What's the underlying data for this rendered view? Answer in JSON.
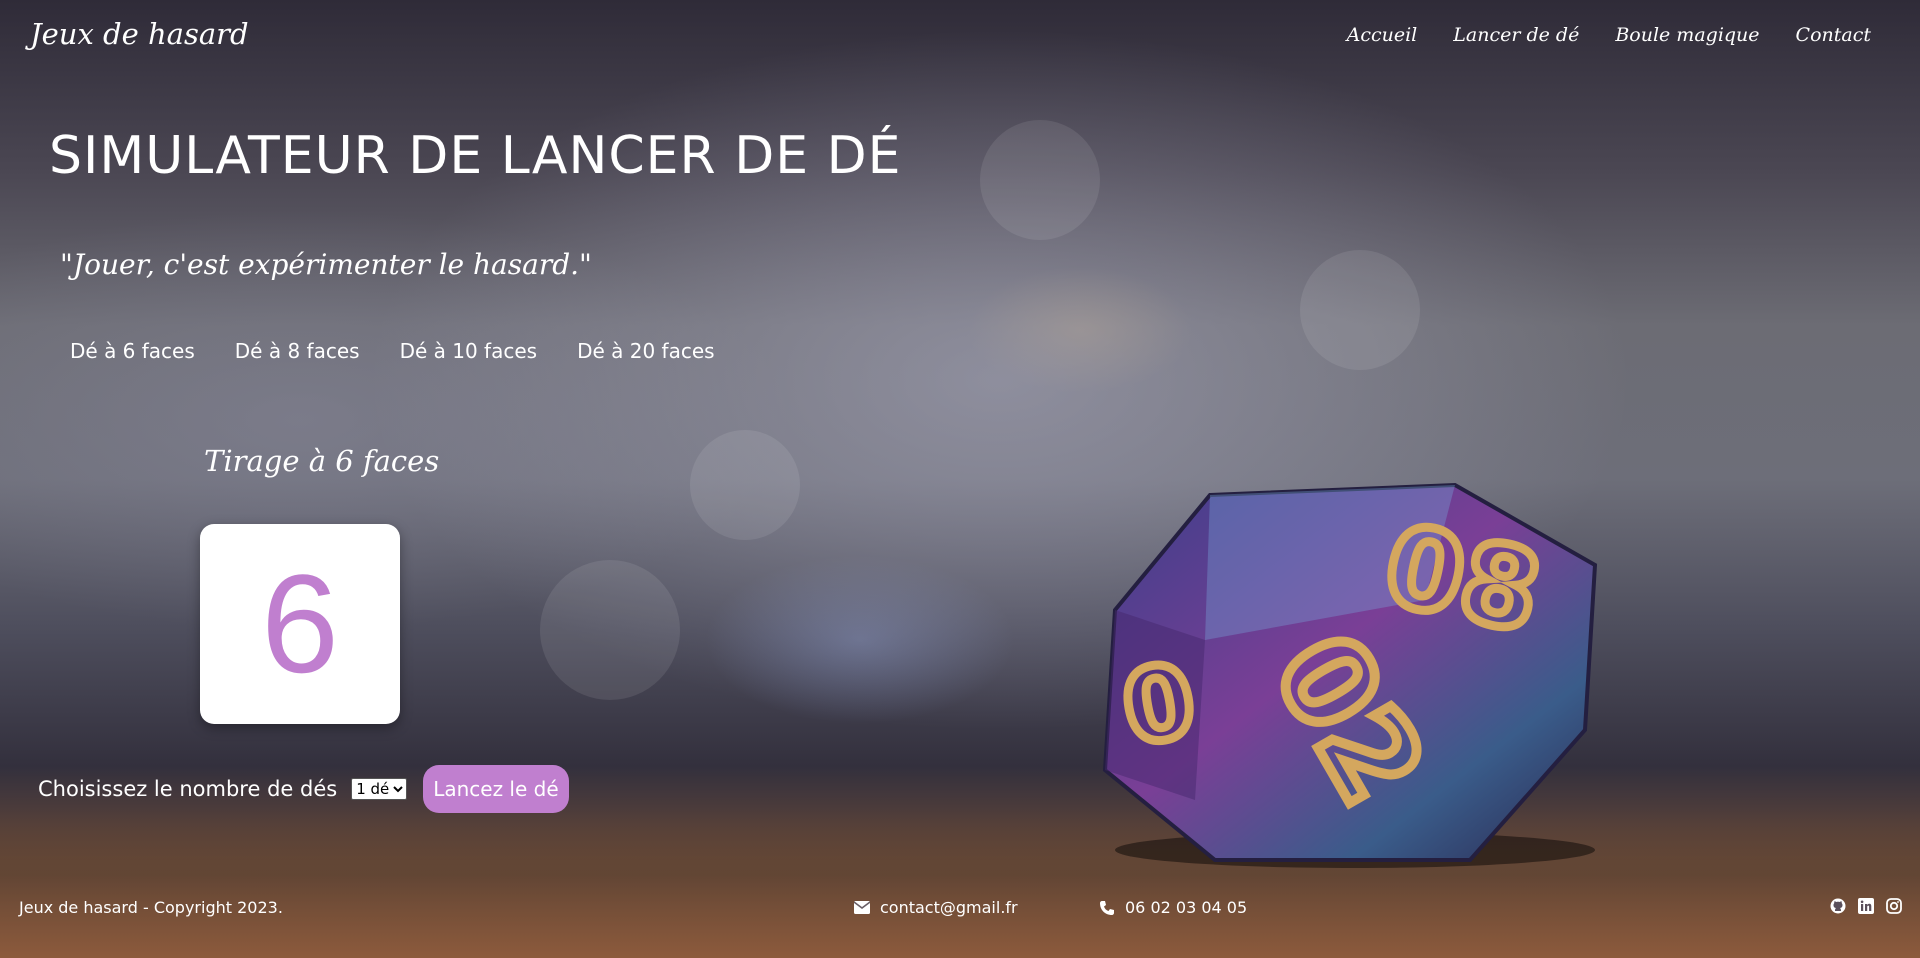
{
  "header": {
    "brand": "Jeux de hasard",
    "nav": [
      "Accueil",
      "Lancer de dé",
      "Boule magique",
      "Contact"
    ]
  },
  "main": {
    "title": "SIMULATEUR DE LANCER DE DÉ",
    "quote": "\"Jouer, c'est expérimenter le hasard.\"",
    "die_tabs": [
      "Dé à 6 faces",
      "Dé à 8 faces",
      "Dé à 10 faces",
      "Dé à 20 faces"
    ],
    "draw_title": "Tirage à 6 faces",
    "result": "6",
    "result_color": "#c07fcf",
    "dice_count_label": "Choisissez le nombre de dés",
    "dice_count_selected": "1 dé",
    "roll_button": "Lancez le dé",
    "background_die_numbers": [
      "08",
      "02",
      "0"
    ]
  },
  "footer": {
    "copyright": "Jeux de hasard - Copyright 2023.",
    "email": "contact@gmail.fr",
    "phone": "06 02 03 04 05",
    "socials": [
      "github-icon",
      "linkedin-icon",
      "instagram-icon"
    ]
  }
}
